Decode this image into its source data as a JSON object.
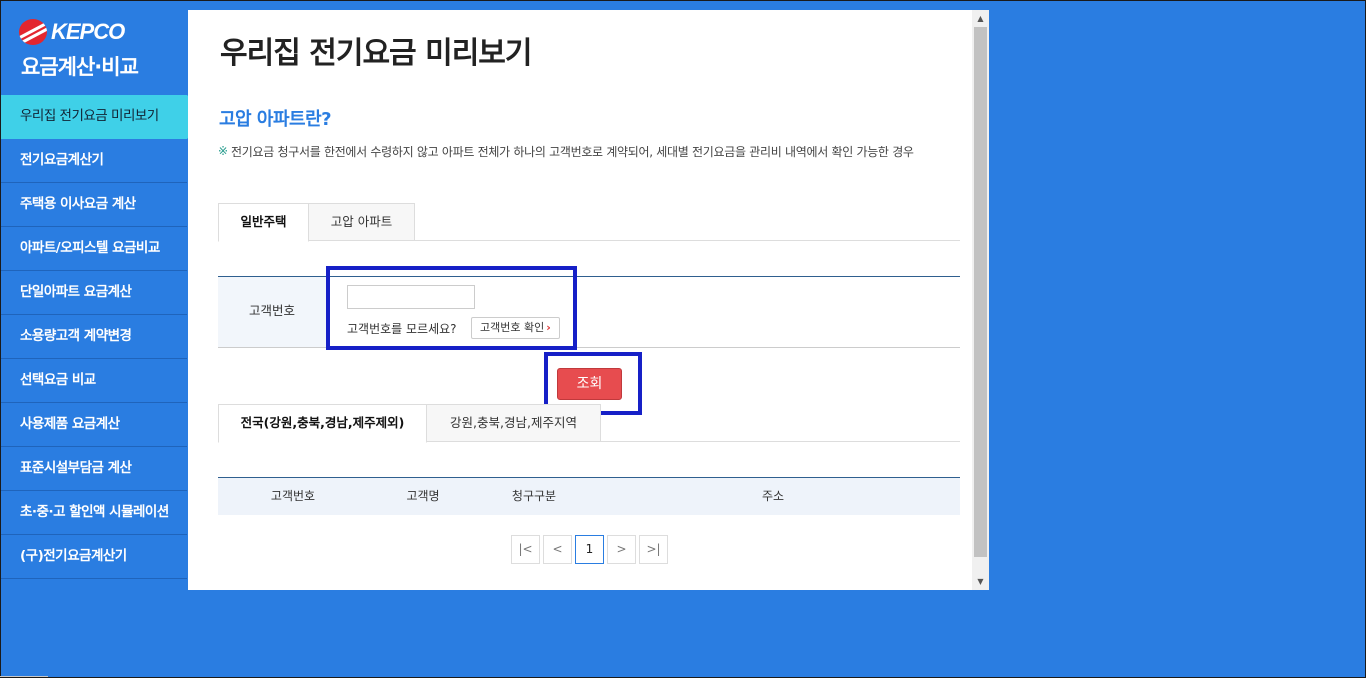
{
  "brand": {
    "logo_text": "KEPCO",
    "subtitle": "요금계산·비교"
  },
  "sidebar": {
    "items": [
      {
        "label": "우리집 전기요금 미리보기",
        "active": true
      },
      {
        "label": "전기요금계산기"
      },
      {
        "label": "주택용 이사요금 계산"
      },
      {
        "label": "아파트/오피스텔 요금비교"
      },
      {
        "label": "단일아파트 요금계산"
      },
      {
        "label": "소용량고객 계약변경"
      },
      {
        "label": "선택요금 비교"
      },
      {
        "label": "사용제품 요금계산"
      },
      {
        "label": "표준시설부담금 계산"
      },
      {
        "label": "초·중·고 할인액 시뮬레이션"
      },
      {
        "label": "(구)전기요금계산기"
      }
    ]
  },
  "main": {
    "title": "우리집 전기요금 미리보기",
    "section_title": "고압 아파트란?",
    "note_mark": "※",
    "note": "전기요금 청구서를 한전에서 수령하지 않고 아파트 전체가 하나의 고객번호로 계약되어, 세대별 전기요금을 관리비 내역에서 확인 가능한 경우",
    "tabs": [
      {
        "label": "일반주택"
      },
      {
        "label": "고압 아파트"
      }
    ],
    "form": {
      "label": "고객번호",
      "input_value": "",
      "input_placeholder": "",
      "help_text": "고객번호를 모르세요?",
      "help_button": "고객번호 확인"
    },
    "search_button": "조회",
    "region_tabs": [
      {
        "label": "전국(강원,충북,경남,제주제외)"
      },
      {
        "label": "강원,충북,경남,제주지역"
      }
    ],
    "table": {
      "columns": [
        "고객번호",
        "고객명",
        "청구구분",
        "주소"
      ]
    },
    "pagination": {
      "first": "|<",
      "prev": "<",
      "current": "1",
      "next": ">",
      "last": ">|"
    }
  },
  "colors": {
    "background": "#2a7de1",
    "active_nav": "#3fd0e8",
    "accent_text": "#2a7de1",
    "search_button": "#e74c4f",
    "highlight_box": "#1620c7"
  }
}
